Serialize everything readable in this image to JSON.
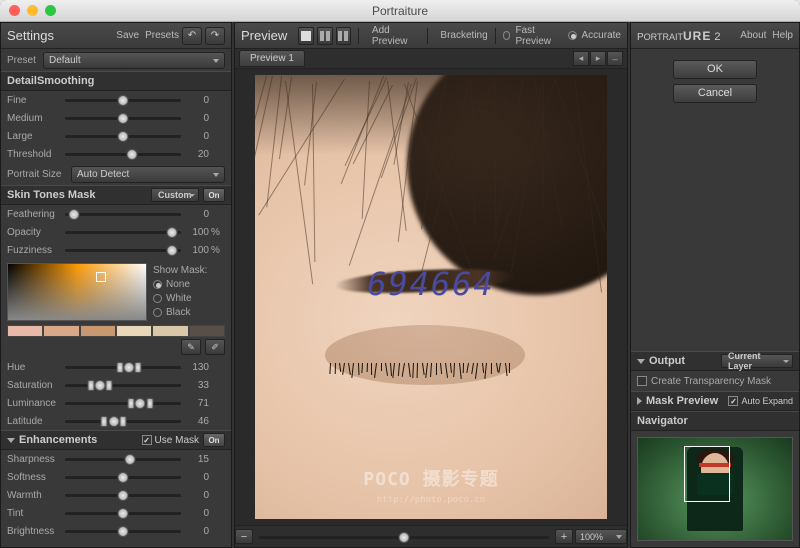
{
  "titlebar": {
    "title": "Portraiture"
  },
  "left": {
    "header": {
      "title": "Settings",
      "save": "Save",
      "presets": "Presets"
    },
    "preset": {
      "label": "Preset",
      "value": "Default"
    },
    "detail": {
      "title": "DetailSmoothing",
      "sliders": [
        {
          "label": "Fine",
          "value": "0",
          "pos": 50
        },
        {
          "label": "Medium",
          "value": "0",
          "pos": 50
        },
        {
          "label": "Large",
          "value": "0",
          "pos": 50
        },
        {
          "label": "Threshold",
          "value": "20",
          "pos": 58
        }
      ],
      "portrait_size": {
        "label": "Portrait Size",
        "value": "Auto Detect"
      }
    },
    "skin": {
      "title": "Skin Tones Mask",
      "custom": "Custom",
      "on": "On",
      "sliders": [
        {
          "label": "Feathering",
          "value": "0",
          "unit": "",
          "pos": 8
        },
        {
          "label": "Opacity",
          "value": "100",
          "unit": "%",
          "pos": 92
        },
        {
          "label": "Fuzziness",
          "value": "100",
          "unit": "%",
          "pos": 92
        }
      ],
      "showmask": {
        "label": "Show Mask:",
        "options": [
          "None",
          "White",
          "Black"
        ],
        "selected": 0
      },
      "sliders2": [
        {
          "label": "Hue",
          "value": "130",
          "pos": 55
        },
        {
          "label": "Saturation",
          "value": "33",
          "pos": 30
        },
        {
          "label": "Luminance",
          "value": "71",
          "pos": 65
        },
        {
          "label": "Latitude",
          "value": "46",
          "pos": 42
        }
      ]
    },
    "enh": {
      "title": "Enhancements",
      "usemask": "Use Mask",
      "on": "On",
      "sliders": [
        {
          "label": "Sharpness",
          "value": "15",
          "pos": 56
        },
        {
          "label": "Softness",
          "value": "0",
          "pos": 50
        },
        {
          "label": "Warmth",
          "value": "0",
          "pos": 50
        },
        {
          "label": "Tint",
          "value": "0",
          "pos": 50
        },
        {
          "label": "Brightness",
          "value": "0",
          "pos": 50
        }
      ]
    }
  },
  "center": {
    "header": {
      "title": "Preview",
      "add": "Add Preview",
      "bracket": "Bracketing",
      "fast": "Fast Preview",
      "accurate": "Accurate"
    },
    "tab": "Preview 1",
    "watermark": {
      "id": "694664",
      "brand": "POCO 摄影专题",
      "url": "http://photo.poco.cn"
    },
    "zoom": "100%"
  },
  "right": {
    "brand": {
      "name": "PORTRAITURE",
      "ver": "2",
      "about": "About",
      "help": "Help"
    },
    "ok": "OK",
    "cancel": "Cancel",
    "output": {
      "title": "Output",
      "layer": "Current Layer",
      "transp": "Create Transparency Mask"
    },
    "maskprev": {
      "title": "Mask Preview",
      "auto": "Auto Expand"
    },
    "nav": {
      "title": "Navigator"
    }
  }
}
